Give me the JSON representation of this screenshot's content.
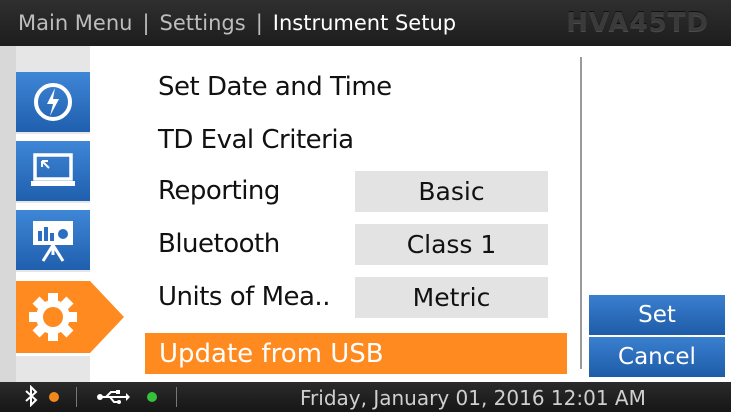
{
  "header": {
    "breadcrumb": [
      "Main Menu",
      "Settings",
      "Instrument Setup"
    ],
    "model": "HVA45TD"
  },
  "sidebar": {
    "items": [
      {
        "icon": "power-icon",
        "active": false
      },
      {
        "icon": "monitor-icon",
        "active": false
      },
      {
        "icon": "presentation-icon",
        "active": false
      },
      {
        "icon": "gear-icon",
        "active": true
      }
    ]
  },
  "menu": {
    "rows": [
      {
        "label": "Set Date and Time"
      },
      {
        "label": "TD Eval Criteria"
      },
      {
        "label": "Reporting",
        "value": "Basic"
      },
      {
        "label": "Bluetooth",
        "value": "Class 1"
      },
      {
        "label": "Units of Mea..",
        "value": "Metric"
      },
      {
        "label": "Update from USB",
        "selected": true
      }
    ]
  },
  "buttons": {
    "set": "Set",
    "cancel": "Cancel"
  },
  "status": {
    "bluetooth_icon": "bluetooth-icon",
    "bluetooth_dot_color": "#f08a1c",
    "usb_icon": "usb-icon",
    "usb_dot_color": "#35c23a",
    "datetime": "Friday, January 01, 2016 12:01 AM"
  },
  "colors": {
    "accent_blue": "#2a6fc2",
    "highlight_orange": "#ff8a1f",
    "value_box_gray": "#e3e3e3"
  }
}
